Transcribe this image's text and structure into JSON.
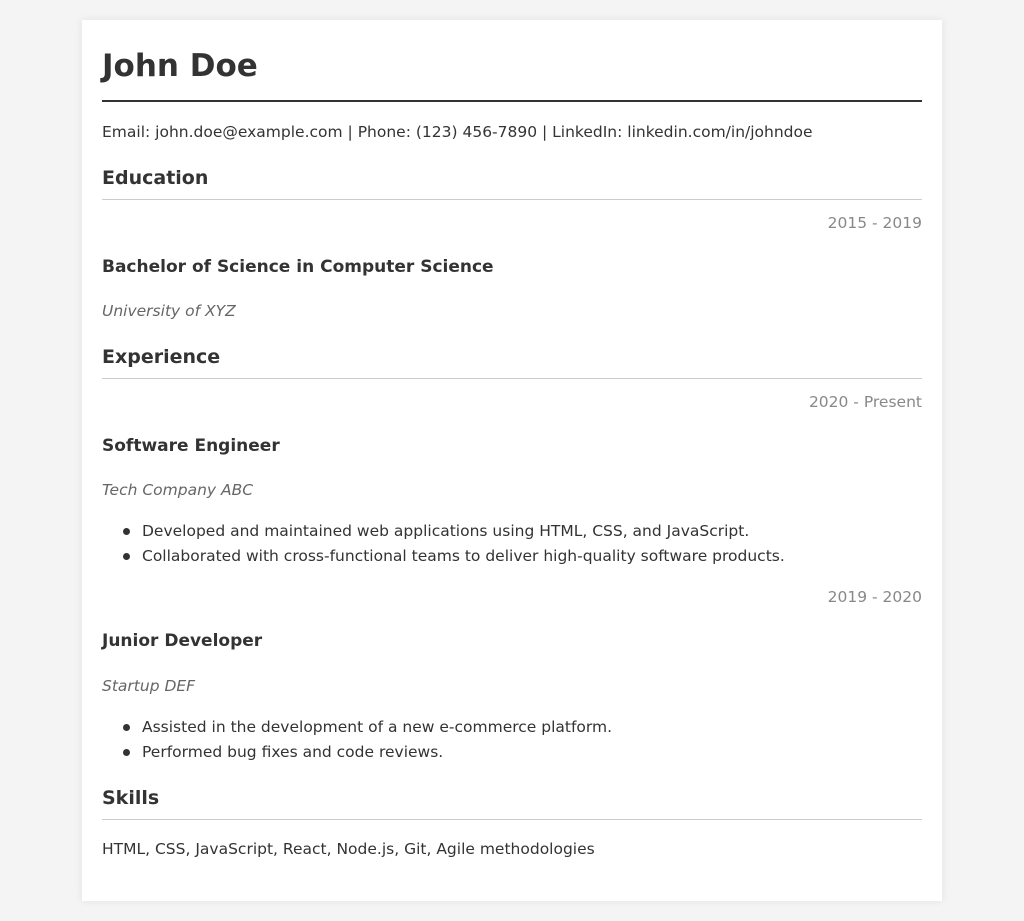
{
  "name": "John Doe",
  "contact": "Email: john.doe@example.com | Phone: (123) 456-7890 | LinkedIn: linkedin.com/in/johndoe",
  "education": {
    "title": "Education",
    "entries": [
      {
        "dates": "2015 - 2019",
        "degree": "Bachelor of Science in Computer Science",
        "school": "University of XYZ"
      }
    ]
  },
  "experience": {
    "title": "Experience",
    "entries": [
      {
        "dates": "2020 - Present",
        "role": "Software Engineer",
        "company": "Tech Company ABC",
        "bullets": [
          "Developed and maintained web applications using HTML, CSS, and JavaScript.",
          "Collaborated with cross-functional teams to deliver high-quality software products."
        ]
      },
      {
        "dates": "2019 - 2020",
        "role": "Junior Developer",
        "company": "Startup DEF",
        "bullets": [
          "Assisted in the development of a new e-commerce platform.",
          "Performed bug fixes and code reviews."
        ]
      }
    ]
  },
  "skills": {
    "title": "Skills",
    "text": "HTML, CSS, JavaScript, React, Node.js, Git, Agile methodologies"
  },
  "colors": {
    "page_background": "#f4f4f4",
    "card_background": "#ffffff",
    "text": "#333333",
    "muted_date": "#888888",
    "muted_org": "#666666",
    "rule": "#cccccc"
  }
}
